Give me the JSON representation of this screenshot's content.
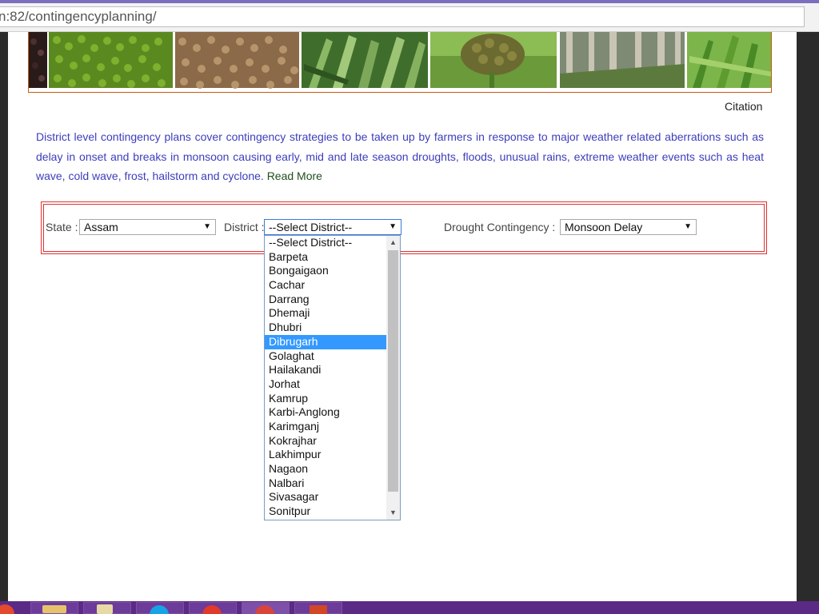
{
  "browser": {
    "url": "n:82/contingencyplanning/"
  },
  "header": {
    "banner_images": [
      "black-seeds",
      "green-gram",
      "brown-lentils",
      "pearl-millet-field",
      "sorghum-head",
      "sorghum-stalks",
      "green-crop"
    ],
    "citation_link": "Citation"
  },
  "intro": {
    "text": "District level contingency plans cover contingency strategies to be taken up by farmers in response to major weather related aberrations such as delay in onset and breaks in monsoon causing early, mid and late season droughts, floods, unusual rains, extreme weather events such as heat wave, cold wave, frost, hailstorm and cyclone.",
    "read_more": "Read More"
  },
  "filters": {
    "state_label": "State :",
    "state_value": "Assam",
    "district_label": "District :",
    "district_value": "--Select District--",
    "drought_label": "Drought Contingency :",
    "drought_value": "Monsoon Delay"
  },
  "district_dropdown": {
    "options": [
      "--Select District--",
      "Barpeta",
      "Bongaigaon",
      "Cachar",
      "Darrang",
      "Dhemaji",
      "Dhubri",
      "Dibrugarh",
      "Golaghat",
      "Hailakandi",
      "Jorhat",
      "Kamrup",
      "Karbi-Anglong",
      "Karimganj",
      "Kokrajhar",
      "Lakhimpur",
      "Nagaon",
      "Nalbari",
      "Sivasagar",
      "Sonitpur"
    ],
    "highlighted": "Dibrugarh"
  },
  "colors": {
    "intro_text": "#3d3dbd",
    "filter_border": "#dd3333",
    "highlight": "#3399ff",
    "taskbar": "#5b2a86"
  }
}
